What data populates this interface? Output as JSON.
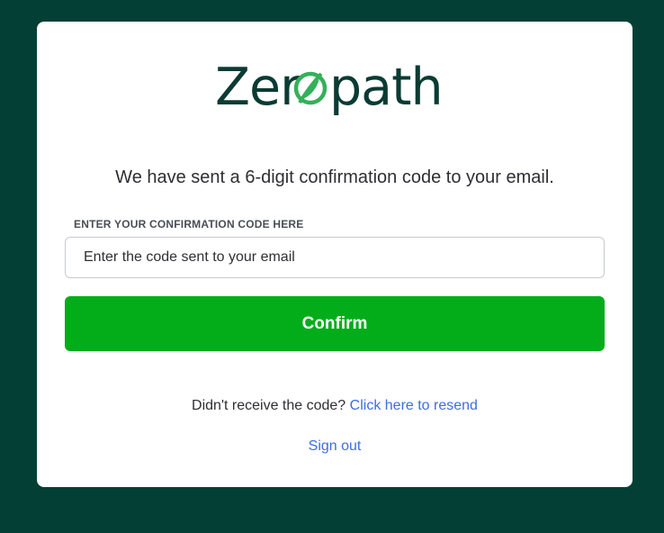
{
  "brand": {
    "logo_prefix": "Zer",
    "logo_suffix": "path",
    "dark_color": "#0b3b33",
    "accent_color": "#35b05a"
  },
  "colors": {
    "background": "#043f36",
    "card": "#ffffff",
    "primary_button": "#03ad1a",
    "link": "#3b6ee0"
  },
  "verification": {
    "message": "We have sent a 6-digit confirmation code to your email.",
    "field_label": "ENTER YOUR CONFIRMATION CODE HERE",
    "code_placeholder": "Enter the code sent to your email",
    "code_value": "",
    "confirm_label": "Confirm",
    "resend_prompt": "Didn't receive the code?",
    "resend_link": "Click here to resend",
    "signout_link": "Sign out"
  }
}
